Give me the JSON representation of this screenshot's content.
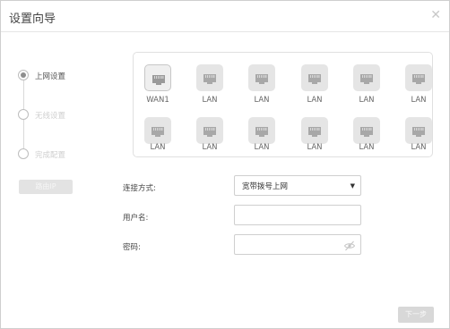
{
  "dialog": {
    "title": "设置向导"
  },
  "steps": [
    {
      "label": "上网设置",
      "active": true
    },
    {
      "label": "无线设置",
      "active": false
    },
    {
      "label": "完成配置",
      "active": false
    }
  ],
  "left_button": {
    "label": "路由IP"
  },
  "ports": {
    "row1": [
      "WAN1",
      "LAN",
      "LAN",
      "LAN",
      "LAN",
      "LAN"
    ],
    "row2": [
      "LAN",
      "LAN",
      "LAN",
      "LAN",
      "LAN",
      "LAN"
    ]
  },
  "form": {
    "connection_label": "连接方式:",
    "connection_value": "宽带拨号上网",
    "username_label": "用户名:",
    "username_value": "",
    "password_label": "密码:",
    "password_value": ""
  },
  "footer": {
    "next_label": "下一步"
  }
}
